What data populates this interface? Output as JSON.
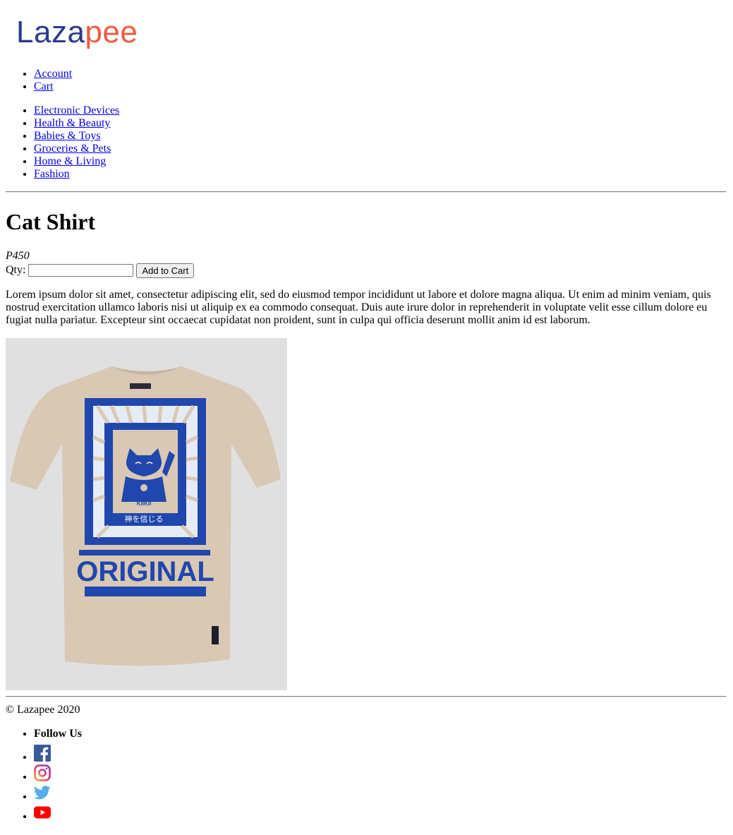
{
  "brand": {
    "logo_part1": "Laza",
    "logo_part2": "pee",
    "color1": "#2b3a8c",
    "color2": "#ef5b3f"
  },
  "account_nav": [
    {
      "label": "Account"
    },
    {
      "label": "Cart"
    }
  ],
  "category_nav": [
    {
      "label": "Electronic Devices"
    },
    {
      "label": "Health & Beauty"
    },
    {
      "label": "Babies & Toys"
    },
    {
      "label": "Groceries & Pets"
    },
    {
      "label": "Home & Living"
    },
    {
      "label": "Fashion"
    }
  ],
  "product": {
    "title": "Cat Shirt",
    "price": "P450",
    "qty_label": "Qty:",
    "qty_value": "",
    "add_button": "Add to Cart",
    "description": "Lorem ipsum dolor sit amet, consectetur adipiscing elit, sed do eiusmod tempor incididunt ut labore et dolore magna aliqua. Ut enim ad minim veniam, quis nostrud exercitation ullamco laboris nisi ut aliquip ex ea commodo consequat. Duis aute irure dolor in reprehenderit in voluptate velit esse cillum dolore eu fugiat nulla pariatur. Excepteur sint occaecat cupidatat non proident, sunt in culpa qui officia deserunt mollit anim id est laborum.",
    "image": {
      "print_text": "ORIGINAL",
      "brand_tag": "KIIKII",
      "japanese_text": "神を信じる",
      "shirt_color": "#d9c8b4",
      "print_color": "#1f47ad"
    }
  },
  "footer": {
    "copyright": "© Lazapee 2020",
    "follow_label": "Follow Us",
    "social": [
      {
        "icon": "facebook-icon",
        "color": "#3b5998"
      },
      {
        "icon": "instagram-icon",
        "color": "#c13584"
      },
      {
        "icon": "twitter-icon",
        "color": "#55acee"
      },
      {
        "icon": "youtube-icon",
        "color": "#ff0000"
      }
    ]
  }
}
